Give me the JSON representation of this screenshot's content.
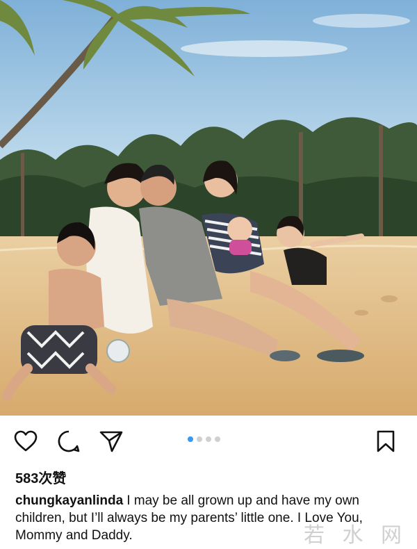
{
  "post": {
    "likes_text": "583次赞",
    "username": "chungkayanlinda",
    "caption": "I may be all grown up and have my own children, but I’ll always be my parents’ little one. I Love You, Mommy and Daddy.",
    "carousel": {
      "total": 4,
      "current": 1
    }
  },
  "icons": {
    "like": "heart-icon",
    "comment": "comment-icon",
    "share": "send-icon",
    "save": "bookmark-icon"
  },
  "colors": {
    "accent": "#3897f0",
    "sky": "#9ec6e4",
    "sand": "#e2c08e"
  },
  "watermark": "若 水 网"
}
